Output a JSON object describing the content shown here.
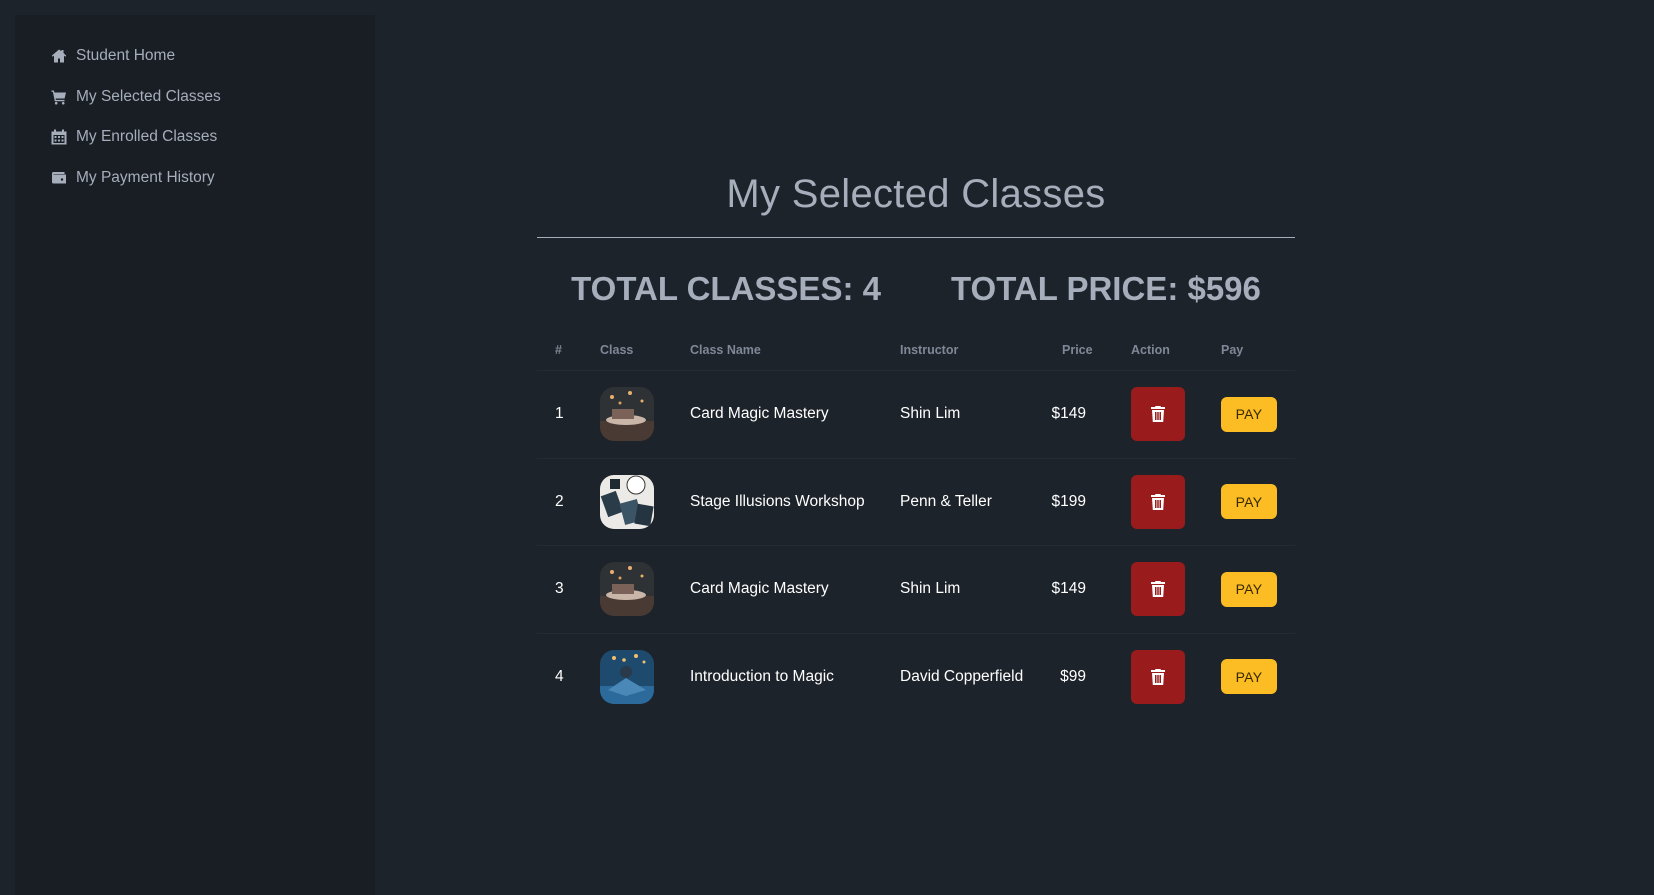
{
  "sidebar": {
    "items": [
      {
        "label": "Student Home",
        "icon": "home-icon"
      },
      {
        "label": "My Selected Classes",
        "icon": "cart-icon"
      },
      {
        "label": "My Enrolled Classes",
        "icon": "calendar-icon"
      },
      {
        "label": "My Payment History",
        "icon": "wallet-icon"
      }
    ]
  },
  "main": {
    "title": "My Selected Classes",
    "total_classes": "TOTAL CLASSES: 4",
    "total_price": "TOTAL PRICE: $596",
    "table": {
      "headers": {
        "num": "#",
        "class": "Class",
        "name": "Class Name",
        "instructor": "Instructor",
        "price": "Price",
        "action": "Action",
        "pay": "Pay"
      },
      "rows": [
        {
          "num": "1",
          "name": "Card Magic Mastery",
          "instructor": "Shin Lim",
          "price": "$149",
          "pay_label": "PAY"
        },
        {
          "num": "2",
          "name": "Stage Illusions Workshop",
          "instructor": "Penn & Teller",
          "price": "$199",
          "pay_label": "PAY"
        },
        {
          "num": "3",
          "name": "Card Magic Mastery",
          "instructor": "Shin Lim",
          "price": "$149",
          "pay_label": "PAY"
        },
        {
          "num": "4",
          "name": "Introduction to Magic",
          "instructor": "David Copperfield",
          "price": "$99",
          "pay_label": "PAY"
        }
      ]
    }
  },
  "colors": {
    "background": "#1d232a",
    "sidebar": "#191e24",
    "text": "#a6adbb",
    "delete": "#991b1b",
    "pay": "#fbbd23"
  }
}
